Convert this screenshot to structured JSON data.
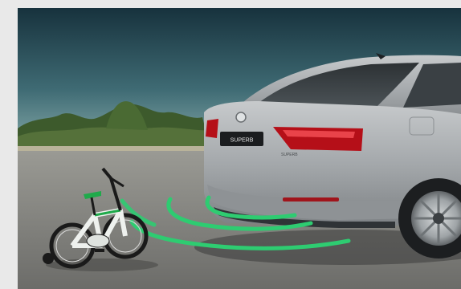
{
  "photo": {
    "plate_text": "SUPERB",
    "badge_text": "SUPERB"
  },
  "colors": {
    "sky_top": "#1e3e4a",
    "sky_horizon": "#7da2a6",
    "ground": "#8d8d88",
    "car_body": "#a9adb0",
    "taillight": "#c2101a",
    "sensor_wave": "#22c55e",
    "bike_frame": "#f2f4f2",
    "bike_accent": "#1faa4b"
  }
}
